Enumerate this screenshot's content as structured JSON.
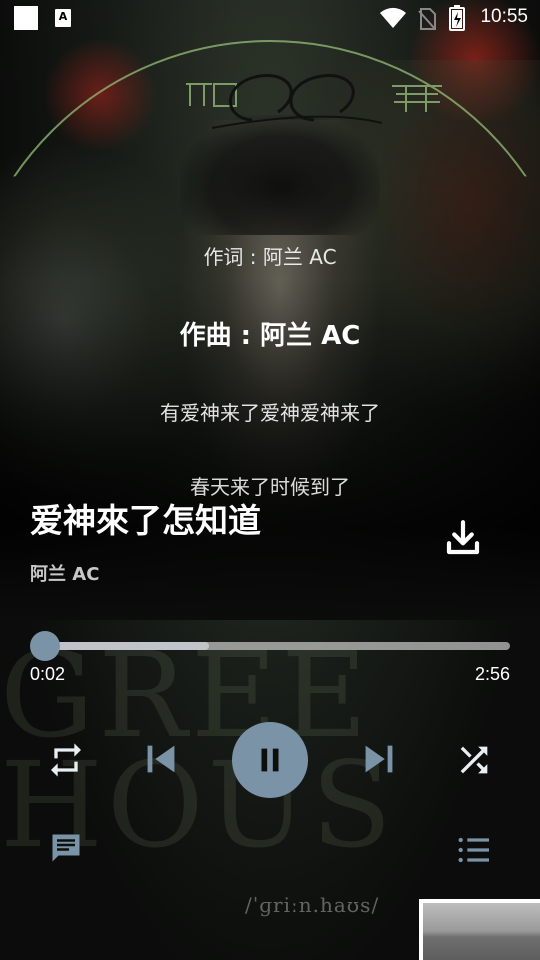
{
  "status_bar": {
    "time": "10:55",
    "app_badge": "A"
  },
  "album_art": {
    "logo_text_left": "阿兰",
    "logo_text_script": "AC",
    "logo_text_right": "青青",
    "watermark_lines": [
      "GREE",
      "HOUS"
    ],
    "phonetic": "/ˈɡriːn.haʊs/"
  },
  "lyrics": [
    "作词 : 阿兰 AC",
    "作曲 : 阿兰 AC",
    "有爱神来了爱神爱神来了",
    "春天来了时候到了"
  ],
  "song": {
    "title": "爱神來了怎知道",
    "artist": "阿兰 AC"
  },
  "playback": {
    "current_time": "0:02",
    "duration": "2:56",
    "progress_fraction": 0.011,
    "buffered_fraction": 0.36,
    "state": "playing"
  },
  "colors": {
    "accent": "#7a93a6",
    "arc": "#96be78"
  },
  "icons": {
    "download": "download-icon",
    "repeat": "repeat-icon",
    "previous": "skip-previous-icon",
    "pause": "pause-icon",
    "next": "skip-next-icon",
    "shuffle": "shuffle-icon",
    "comment": "comment-icon",
    "playlist": "playlist-icon"
  }
}
